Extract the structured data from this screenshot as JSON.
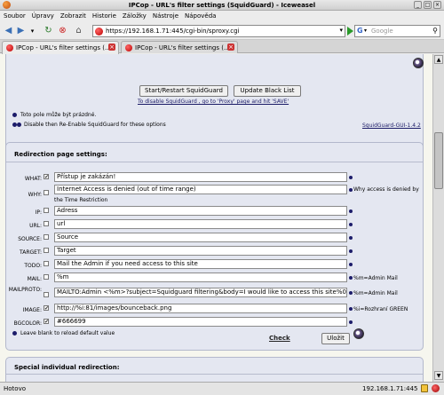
{
  "window": {
    "title": "IPCop - URL's filter settings (SquidGuard) - Iceweasel"
  },
  "menu": [
    "Soubor",
    "Úpravy",
    "Zobrazit",
    "Historie",
    "Záložky",
    "Nástroje",
    "Nápověda"
  ],
  "nav": {
    "url": "https://192.168.1.71:445/cgi-bin/sproxy.cgi",
    "search_engine": "G",
    "search_placeholder": "Google"
  },
  "tabs": [
    {
      "label": "IPCop - URL's filter settings (...",
      "active": true
    },
    {
      "label": "IPCop - URL's filter settings (...",
      "active": false
    }
  ],
  "top_panel": {
    "restart_button": "Start/Restart SquidGuard",
    "update_button": "Update Black List",
    "disable_link": "To disable SquidGuard , go to 'Proxy' page and hit 'SAVE'",
    "empty_note": "Toto pole může být prázdné.",
    "reenable_note": "Disable then Re-Enable SquidGuard for these options",
    "version_link": "SquidGuard-GUI-1.4.2"
  },
  "redirection": {
    "heading": "Redirection page settings:",
    "fields": [
      {
        "label": "WHAT:",
        "checked": true,
        "value": "Přístup je zakázán!",
        "note": ""
      },
      {
        "label": "WHY:",
        "checked": false,
        "value": "Internet Access is denied (out of time range)",
        "note": "Why access is denied by"
      },
      {
        "label": "IP:",
        "checked": false,
        "value": "Adress",
        "note": ""
      },
      {
        "label": "URL:",
        "checked": false,
        "value": "url",
        "note": ""
      },
      {
        "label": "SOURCE:",
        "checked": false,
        "value": "Source",
        "note": ""
      },
      {
        "label": "TARGET:",
        "checked": false,
        "value": "Target",
        "note": ""
      },
      {
        "label": "TODO:",
        "checked": false,
        "value": "Mail the Admin if you need access to this site",
        "note": ""
      },
      {
        "label": "MAIL:",
        "checked": false,
        "value": "%m",
        "note": "%m=Admin Mail"
      },
      {
        "label": "MAILPROTO:",
        "checked": false,
        "value": "MAILTO:Admin <%m>?subject=Squidguard filtering&body=I would like to access this site%0A",
        "note": "%m=Admin Mail"
      },
      {
        "label": "IMAGE:",
        "checked": true,
        "value": "http://%i:81/images/bounceback.png",
        "note": "%i=Rozhraní GREEN"
      },
      {
        "label": "BGCOLOR:",
        "checked": true,
        "value": "#666699",
        "note": ""
      }
    ],
    "why_note_line2": "the Time Restriction",
    "blank_note": "Leave blank to reload default value",
    "check_link": "Check",
    "save_button": "Uložit"
  },
  "special": {
    "heading": "Special individual redirection:"
  },
  "status": {
    "text": "Hotovo",
    "host": "192.168.1.71:445"
  }
}
